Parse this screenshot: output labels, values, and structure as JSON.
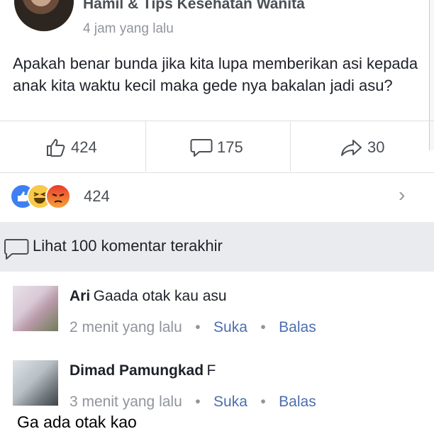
{
  "post": {
    "page_name": "Hamil & Tips Kesehatan Wanita",
    "time": "4 jam yang lalu",
    "text": "Apakah benar bunda jika kita lupa memberikan asi kepada anak kita waktu kecil maka gede nya bakalan jadi asu?"
  },
  "actions": {
    "likes": "424",
    "comments": "175",
    "shares": "30"
  },
  "reactions": {
    "count": "424",
    "types": [
      "like-icon",
      "haha-icon",
      "angry-icon"
    ]
  },
  "comments_bar": {
    "label": "Lihat 100 komentar terakhir"
  },
  "comments": [
    {
      "name": "Ari",
      "text": "Gaada otak kau asu",
      "time": "2 menit yang lalu",
      "like_label": "Suka",
      "reply_label": "Balas"
    },
    {
      "name": "Dimad Pamungkad",
      "text": "F",
      "time": "3 menit yang lalu",
      "like_label": "Suka",
      "reply_label": "Balas"
    }
  ],
  "caption": "Ga ada otak kao",
  "colors": {
    "link": "#4b6fb0",
    "muted": "#90949c",
    "bar_bg": "#e9ebee",
    "like_blue": "#3f7ff2"
  }
}
